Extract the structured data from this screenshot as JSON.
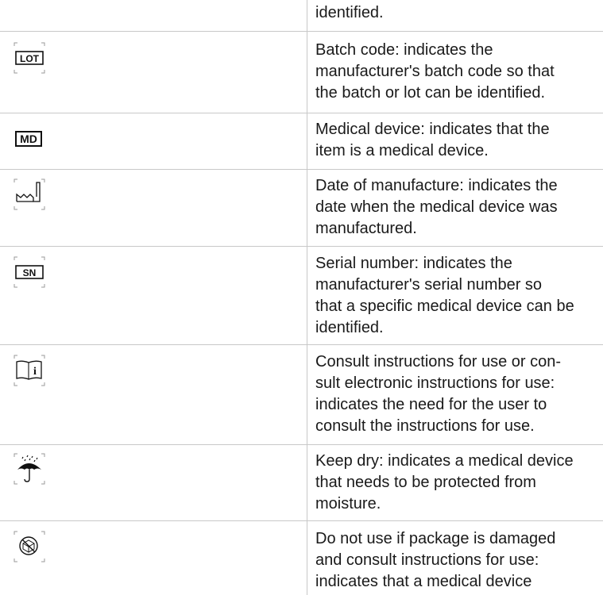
{
  "rows": [
    {
      "id": "continuation",
      "lines": [
        "identified."
      ]
    },
    {
      "id": "batch-code",
      "symbol": "lot-icon",
      "symbol_text": "LOT",
      "lines": [
        "Batch code: indicates the",
        "manufacturer's batch code so that",
        "the batch or lot can be identified."
      ]
    },
    {
      "id": "medical-device",
      "symbol": "md-icon",
      "symbol_text": "MD",
      "lines": [
        "Medical device: indicates that the",
        "item is a medical device."
      ]
    },
    {
      "id": "date-of-manufacture",
      "symbol": "factory-icon",
      "lines": [
        "Date of manufacture: indicates the",
        "date when the medical device was",
        "manufactured."
      ]
    },
    {
      "id": "serial-number",
      "symbol": "sn-icon",
      "symbol_text": "SN",
      "lines": [
        "Serial number: indicates the",
        "manufacturer's serial number so",
        "that a specific medical device can be",
        "identified."
      ]
    },
    {
      "id": "consult-instructions",
      "symbol": "book-info-icon",
      "symbol_text": "i",
      "lines": [
        "Consult instructions for use or con-",
        "sult electronic instructions for use:",
        "indicates the need for the user to",
        "consult the instructions for use."
      ]
    },
    {
      "id": "keep-dry",
      "symbol": "umbrella-icon",
      "lines": [
        "Keep dry: indicates a medical device",
        "that needs to be protected from",
        "moisture."
      ]
    },
    {
      "id": "do-not-use-damaged",
      "symbol": "damaged-package-icon",
      "lines": [
        "Do not use if package is damaged",
        "and consult instructions for use:",
        "indicates that a medical device"
      ]
    }
  ]
}
